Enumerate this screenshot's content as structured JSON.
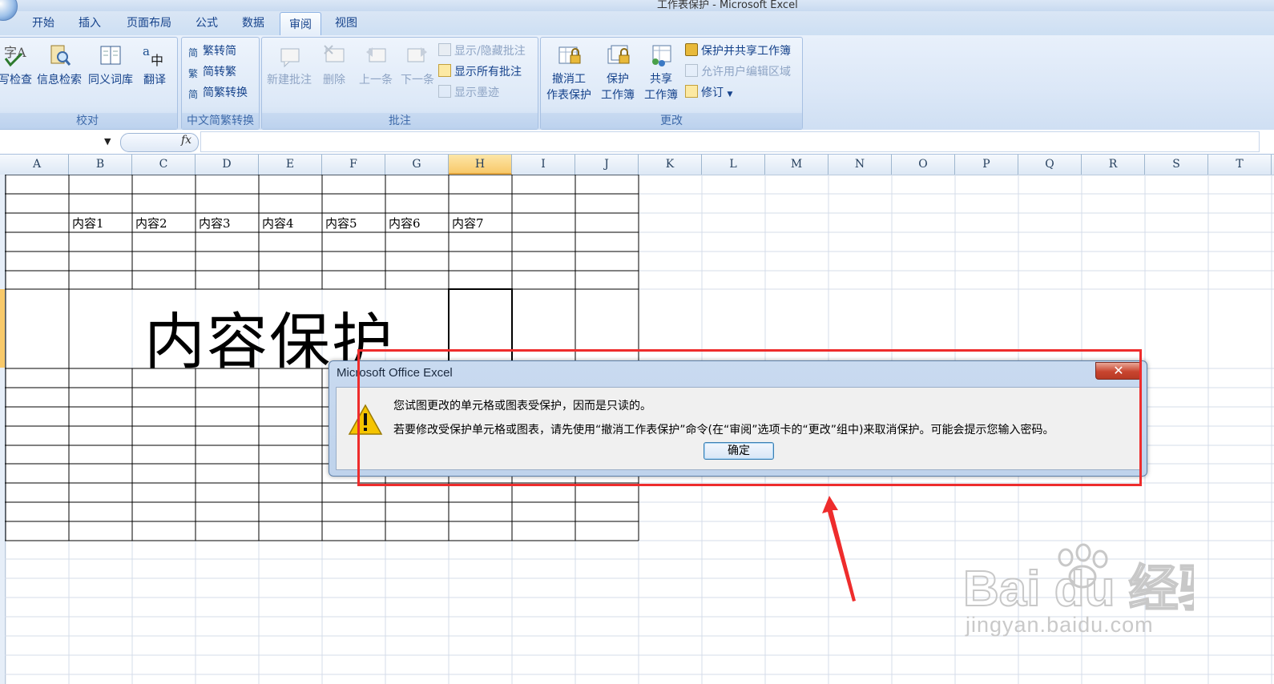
{
  "window": {
    "title": "工作表保护 - Microsoft Excel"
  },
  "tabs": [
    {
      "label": "开始",
      "active": false
    },
    {
      "label": "插入",
      "active": false
    },
    {
      "label": "页面布局",
      "active": false
    },
    {
      "label": "公式",
      "active": false
    },
    {
      "label": "数据",
      "active": false
    },
    {
      "label": "审阅",
      "active": true
    },
    {
      "label": "视图",
      "active": false
    }
  ],
  "ribbon": {
    "proofing": {
      "label": "校对",
      "spelling": "写检查",
      "research": "信息检索",
      "thesaurus": "同义词库",
      "translate": "翻译"
    },
    "chinese_conversion": {
      "label": "中文简繁转换",
      "trad_to_simp": "繁转简",
      "simp_to_trad": "简转繁",
      "conversion": "简繁转换"
    },
    "comments": {
      "label": "批注",
      "new_comment": "新建批注",
      "delete": "删除",
      "previous": "上一条",
      "next": "下一条",
      "show_hide": "显示/隐藏批注",
      "show_all": "显示所有批注",
      "show_ink": "显示墨迹"
    },
    "changes": {
      "label": "更改",
      "unprotect_sheet_line1": "撤消工",
      "unprotect_sheet_line2": "作表保护",
      "protect_workbook_line1": "保护",
      "protect_workbook_line2": "工作簿",
      "share_workbook_line1": "共享",
      "share_workbook_line2": "工作簿",
      "protect_share": "保护并共享工作簿",
      "allow_edit_ranges": "允许用户编辑区域",
      "track_changes": "修订"
    }
  },
  "formula_bar": {
    "fx": "fx"
  },
  "sheet": {
    "columns": [
      "A",
      "B",
      "C",
      "D",
      "E",
      "F",
      "G",
      "H",
      "I",
      "J",
      "K",
      "L",
      "M",
      "N",
      "O",
      "P",
      "Q",
      "R",
      "S",
      "T"
    ],
    "selected_column": "H",
    "row3_cells": [
      "内容1",
      "内容2",
      "内容3",
      "内容4",
      "内容5",
      "内容6",
      "内容7"
    ],
    "merged_text": "内容保护"
  },
  "dialog": {
    "title": "Microsoft Office Excel",
    "close": "✕",
    "message1": "您试图更改的单元格或图表受保护，因而是只读的。",
    "message2": "若要修改受保护单元格或图表，请先使用“撤消工作表保护”命令(在“审阅”选项卡的“更改”组中)来取消保护。可能会提示您输入密码。",
    "ok": "确定"
  },
  "watermark": {
    "brand": "Bai du 经验",
    "url": "jingyan.baidu.com"
  },
  "colors": {
    "highlight": "#ee2c2c",
    "ribbon_text": "#15428b",
    "selected_header": "#f8c96a"
  }
}
